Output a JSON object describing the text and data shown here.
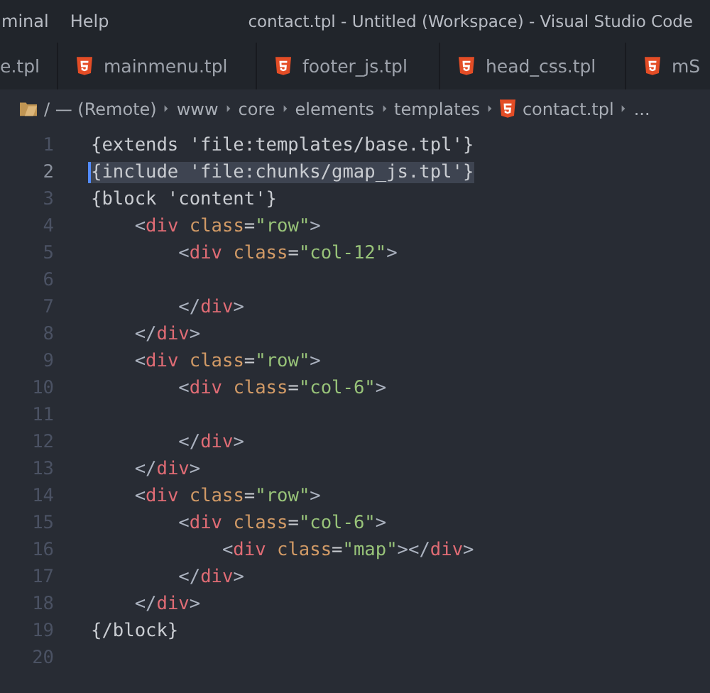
{
  "menu_bar": {
    "items": [
      "minal",
      "Help"
    ],
    "title": "contact.tpl - Untitled (Workspace) - Visual Studio Code"
  },
  "tabs": [
    {
      "label": "e.tpl",
      "selected": false
    },
    {
      "label": "mainmenu.tpl",
      "icon": true,
      "selected": false
    },
    {
      "label": "footer_js.tpl",
      "icon": true,
      "selected": false
    },
    {
      "label": "head_css.tpl",
      "icon": true,
      "selected": false
    },
    {
      "label": "mS",
      "icon": true,
      "selected": false
    }
  ],
  "breadcrumb": [
    {
      "label": "/ — (Remote)",
      "kind": "folder"
    },
    {
      "label": "www",
      "kind": "plain"
    },
    {
      "label": "core",
      "kind": "plain"
    },
    {
      "label": "elements",
      "kind": "plain"
    },
    {
      "label": "templates",
      "kind": "plain"
    },
    {
      "label": "contact.tpl",
      "kind": "file"
    },
    {
      "label": "...",
      "kind": "plain"
    }
  ],
  "editor": {
    "lines": [
      {
        "number": "1",
        "selected": false,
        "tokens": [
          {
            "kind": "plain",
            "text": "{extends 'file:templates/base.tpl'}"
          }
        ]
      },
      {
        "number": "2",
        "selected": true,
        "tokens": [
          {
            "kind": "plain",
            "text": "{include 'file:chunks/gmap_js.tpl'}"
          }
        ]
      },
      {
        "number": "3",
        "selected": false,
        "tokens": [
          {
            "kind": "plain",
            "text": "{block 'content'}"
          }
        ]
      },
      {
        "number": "4",
        "selected": false,
        "tokens": [
          {
            "kind": "punct",
            "text": "    <"
          },
          {
            "kind": "tag",
            "text": "div"
          },
          {
            "kind": "attr",
            "text": " class"
          },
          {
            "kind": "plain",
            "text": "="
          },
          {
            "kind": "string",
            "text": "\"row\""
          },
          {
            "kind": "punct",
            "text": ">"
          }
        ]
      },
      {
        "number": "5",
        "selected": false,
        "tokens": [
          {
            "kind": "punct",
            "text": "        <"
          },
          {
            "kind": "tag",
            "text": "div"
          },
          {
            "kind": "attr",
            "text": " class"
          },
          {
            "kind": "plain",
            "text": "="
          },
          {
            "kind": "string",
            "text": "\"col-12\""
          },
          {
            "kind": "punct",
            "text": ">"
          }
        ]
      },
      {
        "number": "6",
        "selected": false
      },
      {
        "number": "7",
        "selected": false,
        "tokens": [
          {
            "kind": "punct",
            "text": "        </"
          },
          {
            "kind": "tag",
            "text": "div"
          },
          {
            "kind": "punct",
            "text": ">"
          }
        ]
      },
      {
        "number": "8",
        "selected": false,
        "tokens": [
          {
            "kind": "punct",
            "text": "    </"
          },
          {
            "kind": "tag",
            "text": "div"
          },
          {
            "kind": "punct",
            "text": ">"
          }
        ]
      },
      {
        "number": "9",
        "selected": false,
        "tokens": [
          {
            "kind": "punct",
            "text": "    <"
          },
          {
            "kind": "tag",
            "text": "div"
          },
          {
            "kind": "attr",
            "text": " class"
          },
          {
            "kind": "plain",
            "text": "="
          },
          {
            "kind": "string",
            "text": "\"row\""
          },
          {
            "kind": "punct",
            "text": ">"
          }
        ]
      },
      {
        "number": "10",
        "selected": false,
        "tokens": [
          {
            "kind": "punct",
            "text": "        <"
          },
          {
            "kind": "tag",
            "text": "div"
          },
          {
            "kind": "attr",
            "text": " class"
          },
          {
            "kind": "plain",
            "text": "="
          },
          {
            "kind": "string",
            "text": "\"col-6\""
          },
          {
            "kind": "punct",
            "text": ">"
          }
        ]
      },
      {
        "number": "11",
        "selected": false
      },
      {
        "number": "12",
        "selected": false,
        "tokens": [
          {
            "kind": "punct",
            "text": "        </"
          },
          {
            "kind": "tag",
            "text": "div"
          },
          {
            "kind": "punct",
            "text": ">"
          }
        ]
      },
      {
        "number": "13",
        "selected": false,
        "tokens": [
          {
            "kind": "punct",
            "text": "    </"
          },
          {
            "kind": "tag",
            "text": "div"
          },
          {
            "kind": "punct",
            "text": ">"
          }
        ]
      },
      {
        "number": "14",
        "selected": false,
        "tokens": [
          {
            "kind": "punct",
            "text": "    <"
          },
          {
            "kind": "tag",
            "text": "div"
          },
          {
            "kind": "attr",
            "text": " class"
          },
          {
            "kind": "plain",
            "text": "="
          },
          {
            "kind": "string",
            "text": "\"row\""
          },
          {
            "kind": "punct",
            "text": ">"
          }
        ]
      },
      {
        "number": "15",
        "selected": false,
        "tokens": [
          {
            "kind": "punct",
            "text": "        <"
          },
          {
            "kind": "tag",
            "text": "div"
          },
          {
            "kind": "attr",
            "text": " class"
          },
          {
            "kind": "plain",
            "text": "="
          },
          {
            "kind": "string",
            "text": "\"col-6\""
          },
          {
            "kind": "punct",
            "text": ">"
          }
        ]
      },
      {
        "number": "16",
        "selected": false,
        "tokens": [
          {
            "kind": "punct",
            "text": "            <"
          },
          {
            "kind": "tag",
            "text": "div"
          },
          {
            "kind": "attr",
            "text": " class"
          },
          {
            "kind": "plain",
            "text": "="
          },
          {
            "kind": "string",
            "text": "\"map\""
          },
          {
            "kind": "punct",
            "text": "></"
          },
          {
            "kind": "tag",
            "text": "div"
          },
          {
            "kind": "punct",
            "text": ">"
          }
        ]
      },
      {
        "number": "17",
        "selected": false,
        "tokens": [
          {
            "kind": "punct",
            "text": "        </"
          },
          {
            "kind": "tag",
            "text": "div"
          },
          {
            "kind": "punct",
            "text": ">"
          }
        ]
      },
      {
        "number": "18",
        "selected": false,
        "tokens": [
          {
            "kind": "punct",
            "text": "    </"
          },
          {
            "kind": "tag",
            "text": "div"
          },
          {
            "kind": "punct",
            "text": ">"
          }
        ]
      },
      {
        "number": "19",
        "selected": false,
        "tokens": [
          {
            "kind": "plain",
            "text": "{/block}"
          }
        ]
      },
      {
        "number": "20",
        "selected": false
      }
    ]
  }
}
